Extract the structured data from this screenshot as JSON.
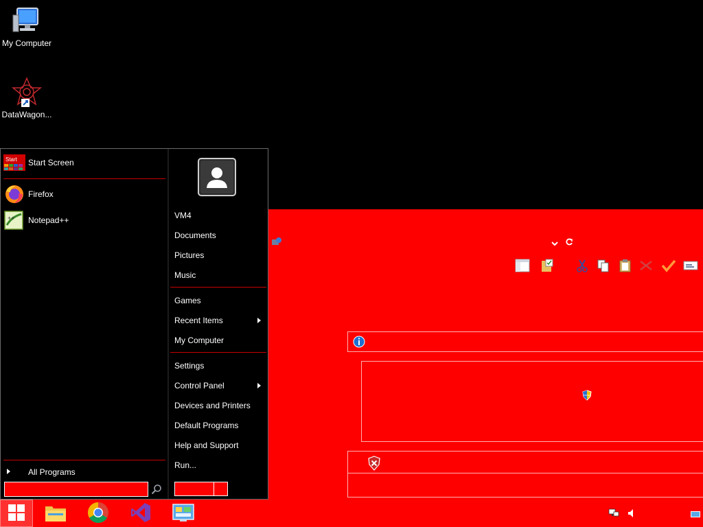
{
  "desktop": {
    "icons": [
      {
        "label": "My Computer",
        "icon": "computer-icon"
      },
      {
        "label": "DataWagon...",
        "icon": "datawagon-shortcut-icon"
      }
    ]
  },
  "start_menu": {
    "pinned": [
      {
        "label": "Start Screen",
        "icon_text": "Start",
        "icon": "start-screen-icon"
      },
      {
        "label": "Firefox",
        "icon": "firefox-icon"
      },
      {
        "label": "Notepad++",
        "icon": "notepadpp-icon"
      }
    ],
    "all_programs_label": "All Programs",
    "search": {
      "value": "",
      "placeholder": ""
    },
    "user": {
      "name": "VM4"
    },
    "right_items": [
      {
        "label": "Documents"
      },
      {
        "label": "Pictures"
      },
      {
        "label": "Music"
      },
      {
        "label": "Games"
      },
      {
        "label": "Recent Items",
        "has_submenu": true
      },
      {
        "label": "My Computer"
      },
      {
        "label": "Settings"
      },
      {
        "label": "Control Panel",
        "has_submenu": true
      },
      {
        "label": "Devices and Printers"
      },
      {
        "label": "Default Programs"
      },
      {
        "label": "Help and Support"
      },
      {
        "label": "Run..."
      }
    ],
    "shutdown_label": ""
  },
  "taskbar": {
    "buttons": [
      "start-button",
      "file-explorer-icon",
      "chrome-icon",
      "visual-studio-icon",
      "control-panel-icon"
    ],
    "tray": [
      "network-icon",
      "volume-icon",
      "show-desktop-icon"
    ]
  },
  "colors": {
    "accent": "#ff0000",
    "menu_bg": "#000000",
    "divider": "#c80000"
  }
}
